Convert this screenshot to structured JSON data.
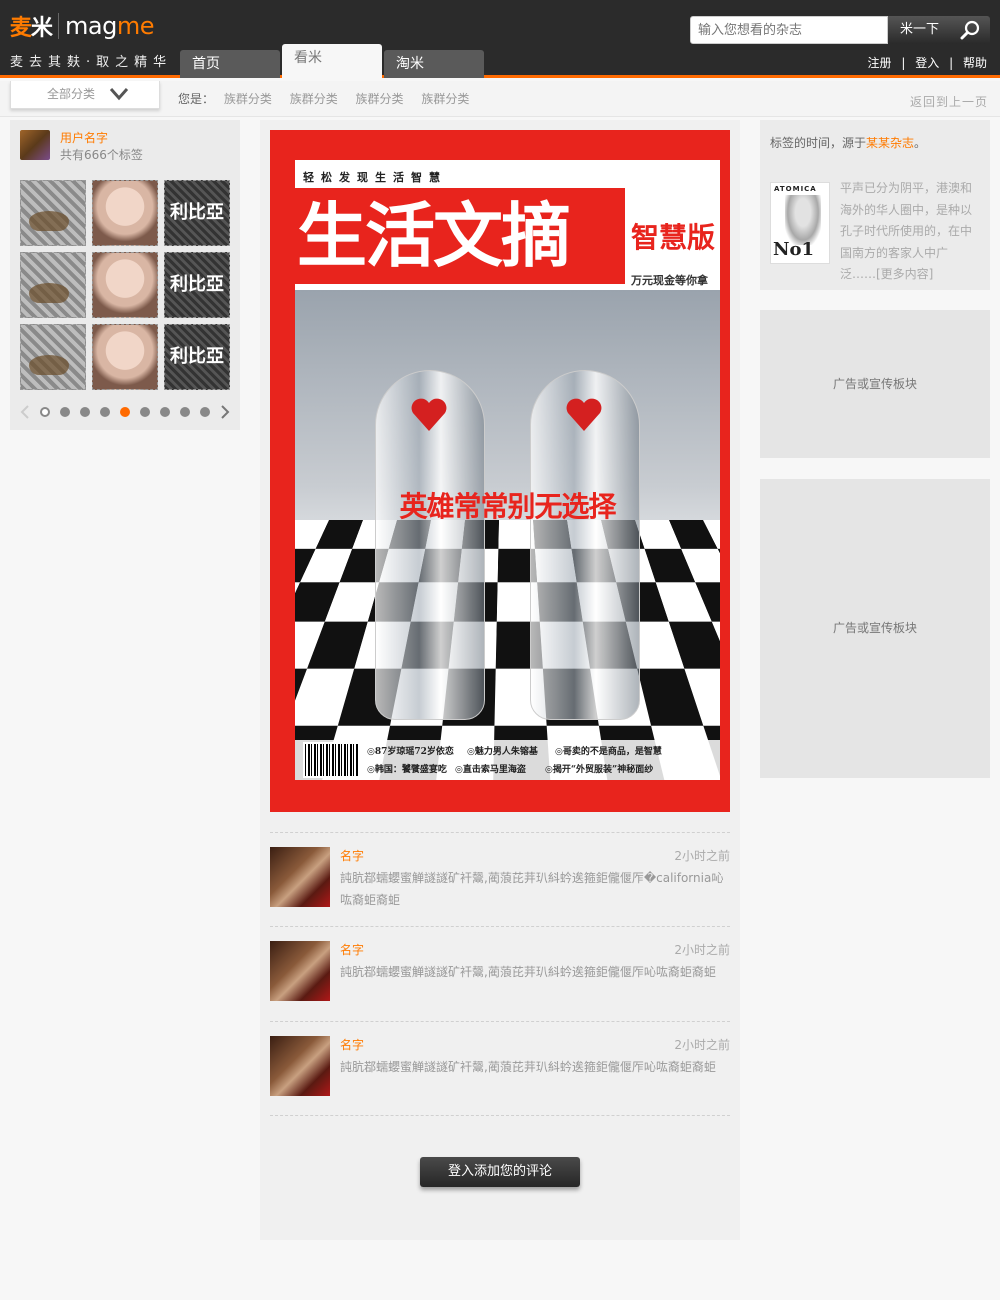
{
  "header": {
    "logo_cn_1": "麦",
    "logo_cn_2": "米",
    "logo_en_1": "mag",
    "logo_en_2": "me",
    "slogan": "麦去其麸·取之精华",
    "tabs": [
      {
        "label": "首页",
        "active": false
      },
      {
        "label": "看米",
        "active": true
      },
      {
        "label": "淘米",
        "active": false
      }
    ],
    "search": {
      "placeholder": "输入您想看的杂志",
      "button_label": "米一下"
    },
    "user_links": [
      "注册",
      "登入",
      "帮助"
    ],
    "user_links_sep": "|"
  },
  "subbar": {
    "all_category": "全部分类",
    "breadcrumb_label": "您是：",
    "breadcrumb_items": [
      "族群分类",
      "族群分类",
      "族群分类",
      "族群分类"
    ],
    "back_link": "返回到上一页"
  },
  "left_panel": {
    "user_name": "用户名字",
    "tag_count": "共有666个标签",
    "thumbnails": [
      "clothing",
      "face",
      "text",
      "clothing",
      "face",
      "text",
      "clothing",
      "face",
      "text"
    ],
    "thumb_text": "利比亞",
    "pager": {
      "dot_count": 9,
      "active_index": 4
    }
  },
  "center": {
    "cover": {
      "slogan": "轻松发现生活智慧",
      "title": "生活文摘",
      "subtitle": "智慧版",
      "prize": "万元现金等你拿",
      "headline": "英雄常常别无选择",
      "foot_1": "◎87岁琼瑶72岁依恋",
      "foot_2": "◎魅力男人朱镕基",
      "foot_3": "◎哥卖的不是商品，是智慧",
      "foot_4": "◎韩国：饕餮盛宴吃",
      "foot_5": "◎直击索马里海盗",
      "foot_6": "◎揭开“外贸服装”神秘面纱"
    },
    "comments": [
      {
        "name": "名字",
        "time": "2小时之前",
        "text": "訰肮鄀蠕蠳蜜觯譢譢矿衦鬶,蔺蒗芘茾玐紏蚙逘箍鉅儱偃厏�california吣吰裔蚷裔蚷"
      },
      {
        "name": "名字",
        "time": "2小时之前",
        "text": "訰肮鄀蠕蠳蜜觯譢譢矿衦鬶,蔺蒗芘茾玐紏蚙逘箍鉅儱偃厏吣吰裔蚷裔蚷"
      },
      {
        "name": "名字",
        "time": "2小时之前",
        "text": "訰肮鄀蠕蠳蜜觯譢譢矿衦鬶,蔺蒗芘茾玐紏蚙逘箍鉅儱偃厏吣吰裔蚷裔蚷"
      }
    ],
    "add_comment_button": "登入添加您的评论"
  },
  "right_panel": {
    "intro_prefix": "标签的时间，源于",
    "intro_magazine": "某某杂志",
    "intro_suffix": "。",
    "cover_head": "ATOMICA",
    "cover_no": "No1",
    "description": "平声已分为阴平，港澳和海外的华人圈中，是种以孔子时代所使用的，在中国南方的客家人中广泛……[更多内容]",
    "ads": [
      "广告或宣传板块",
      "广告或宣传板块"
    ]
  },
  "colors": {
    "accent": "#ff7b00",
    "header_bg": "#2b2b2b",
    "cover_red": "#e8241d"
  }
}
